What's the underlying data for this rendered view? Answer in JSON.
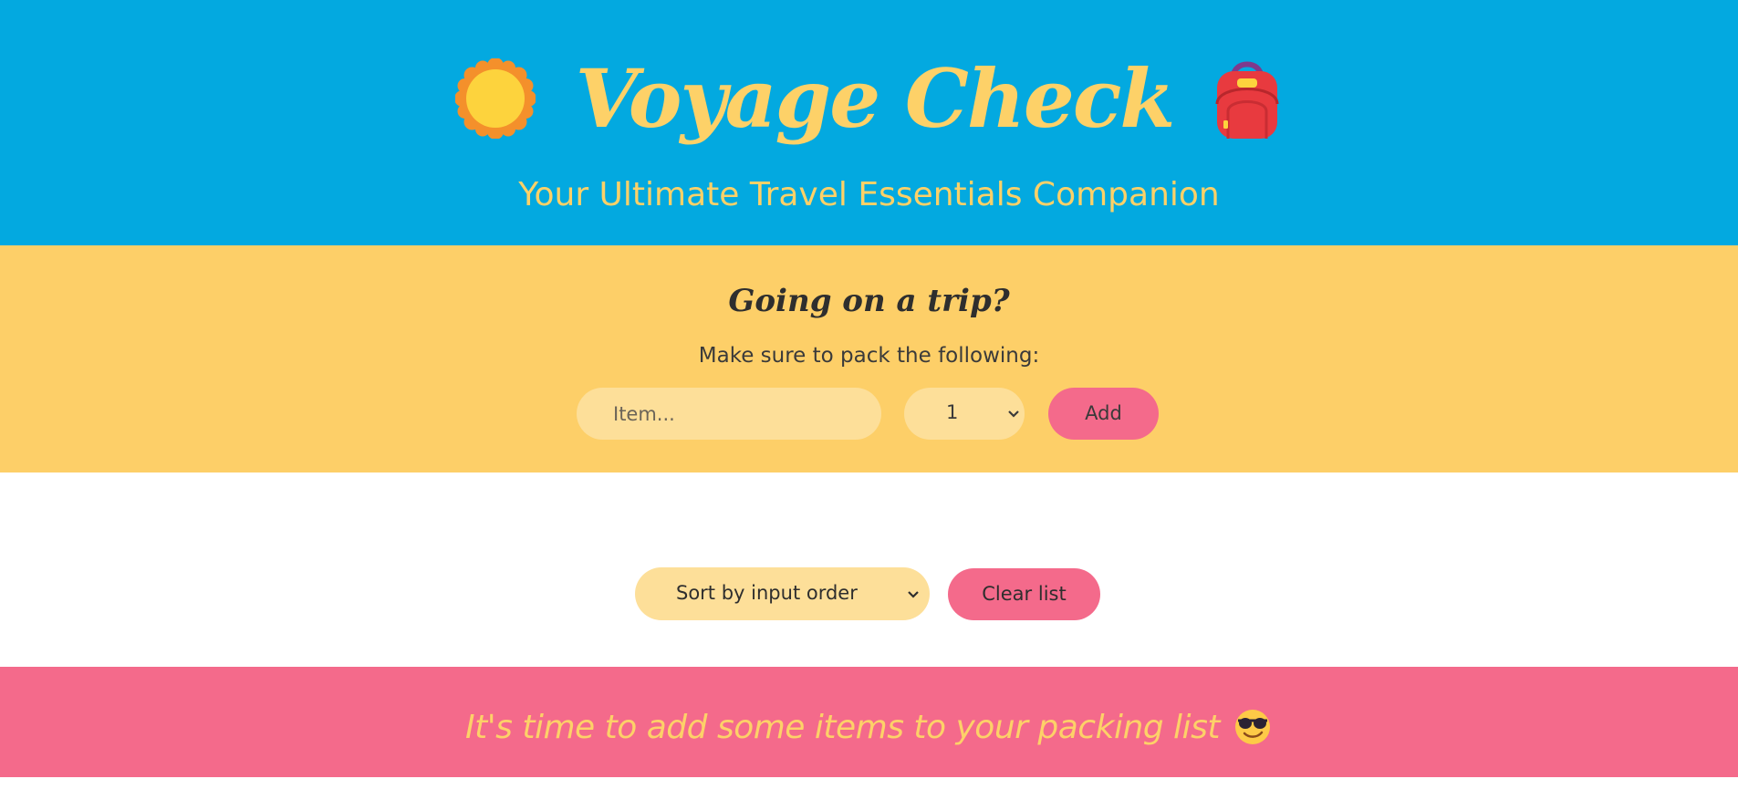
{
  "header": {
    "title": "Voyage Check",
    "subtitle": "Your Ultimate Travel Essentials Companion",
    "left_icon": "sun-icon",
    "right_icon": "backpack-icon"
  },
  "form": {
    "question": "Going on a trip?",
    "instruction": "Make sure to pack the following:",
    "item_placeholder": "Item...",
    "quantity_value": "1",
    "add_label": "Add"
  },
  "list_controls": {
    "sort_value": "Sort by input order",
    "clear_label": "Clear list"
  },
  "footer": {
    "message": "It's time to add some items to your packing list",
    "icon": "sunglasses-smile-icon"
  },
  "colors": {
    "header_bg": "#03a9e0",
    "accent_yellow": "#fdd168",
    "form_bg": "#fdcf68",
    "input_bg": "#fddf99",
    "button_pink": "#f46a8b"
  }
}
